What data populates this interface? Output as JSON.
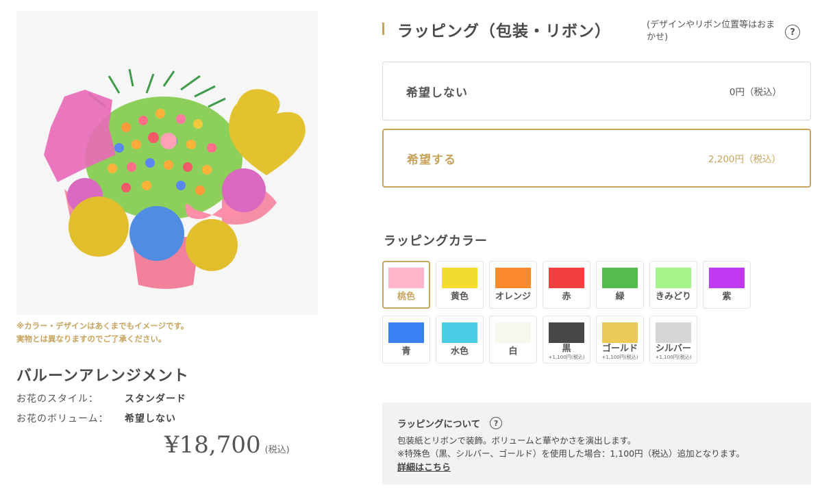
{
  "product": {
    "notice_line1": "※カラー・デザインはあくまでもイメージです。",
    "notice_line2": "実物とは異なりますのでご了承ください。",
    "title": "バルーンアレンジメント",
    "specs": [
      {
        "label": "お花のスタイル：",
        "value": "スタンダード"
      },
      {
        "label": "お花のボリューム：",
        "value": "希望しない"
      }
    ],
    "price": "¥18,700",
    "price_tax": "(税込)"
  },
  "wrapping": {
    "title": "ラッピング（包装・リボン）",
    "note": "(デザインやリボン位置等はおまかせ)",
    "help_glyph": "?",
    "options": [
      {
        "label": "希望しない",
        "price": "0円（税込）",
        "selected": false
      },
      {
        "label": "希望する",
        "price": "2,200円（税込）",
        "selected": true
      }
    ]
  },
  "colors": {
    "title": "ラッピングカラー",
    "items": [
      {
        "label": "桃色",
        "color": "#ffb6c8",
        "selected": true
      },
      {
        "label": "黄色",
        "color": "#f3dc2e"
      },
      {
        "label": "オレンジ",
        "color": "#ff8a2e"
      },
      {
        "label": "赤",
        "color": "#f23f3f"
      },
      {
        "label": "緑",
        "color": "#55bb4e"
      },
      {
        "label": "きみどり",
        "color": "#a6f58a"
      },
      {
        "label": "紫",
        "color": "#c13af2"
      },
      {
        "label": "青",
        "color": "#3a80f2"
      },
      {
        "label": "水色",
        "color": "#4ccde6"
      },
      {
        "label": "白",
        "color": "#f6f8ee"
      },
      {
        "label": "黒",
        "color": "#484848",
        "extra": "+1,100円(税込)"
      },
      {
        "label": "ゴールド",
        "color": "#ebc957",
        "extra": "+1,100円(税込)"
      },
      {
        "label": "シルバー",
        "color": "#d6d5d8",
        "extra": "+1,100円(税込)"
      }
    ]
  },
  "info": {
    "title": "ラッピングについて",
    "line1": "包装紙とリボンで装飾。ボリュームと華やかさを演出します。",
    "line2": "※特殊色（黒、シルバー、ゴールド）を使用した場合：1,100円（税込）追加となります。",
    "link": "詳細はこちら"
  }
}
